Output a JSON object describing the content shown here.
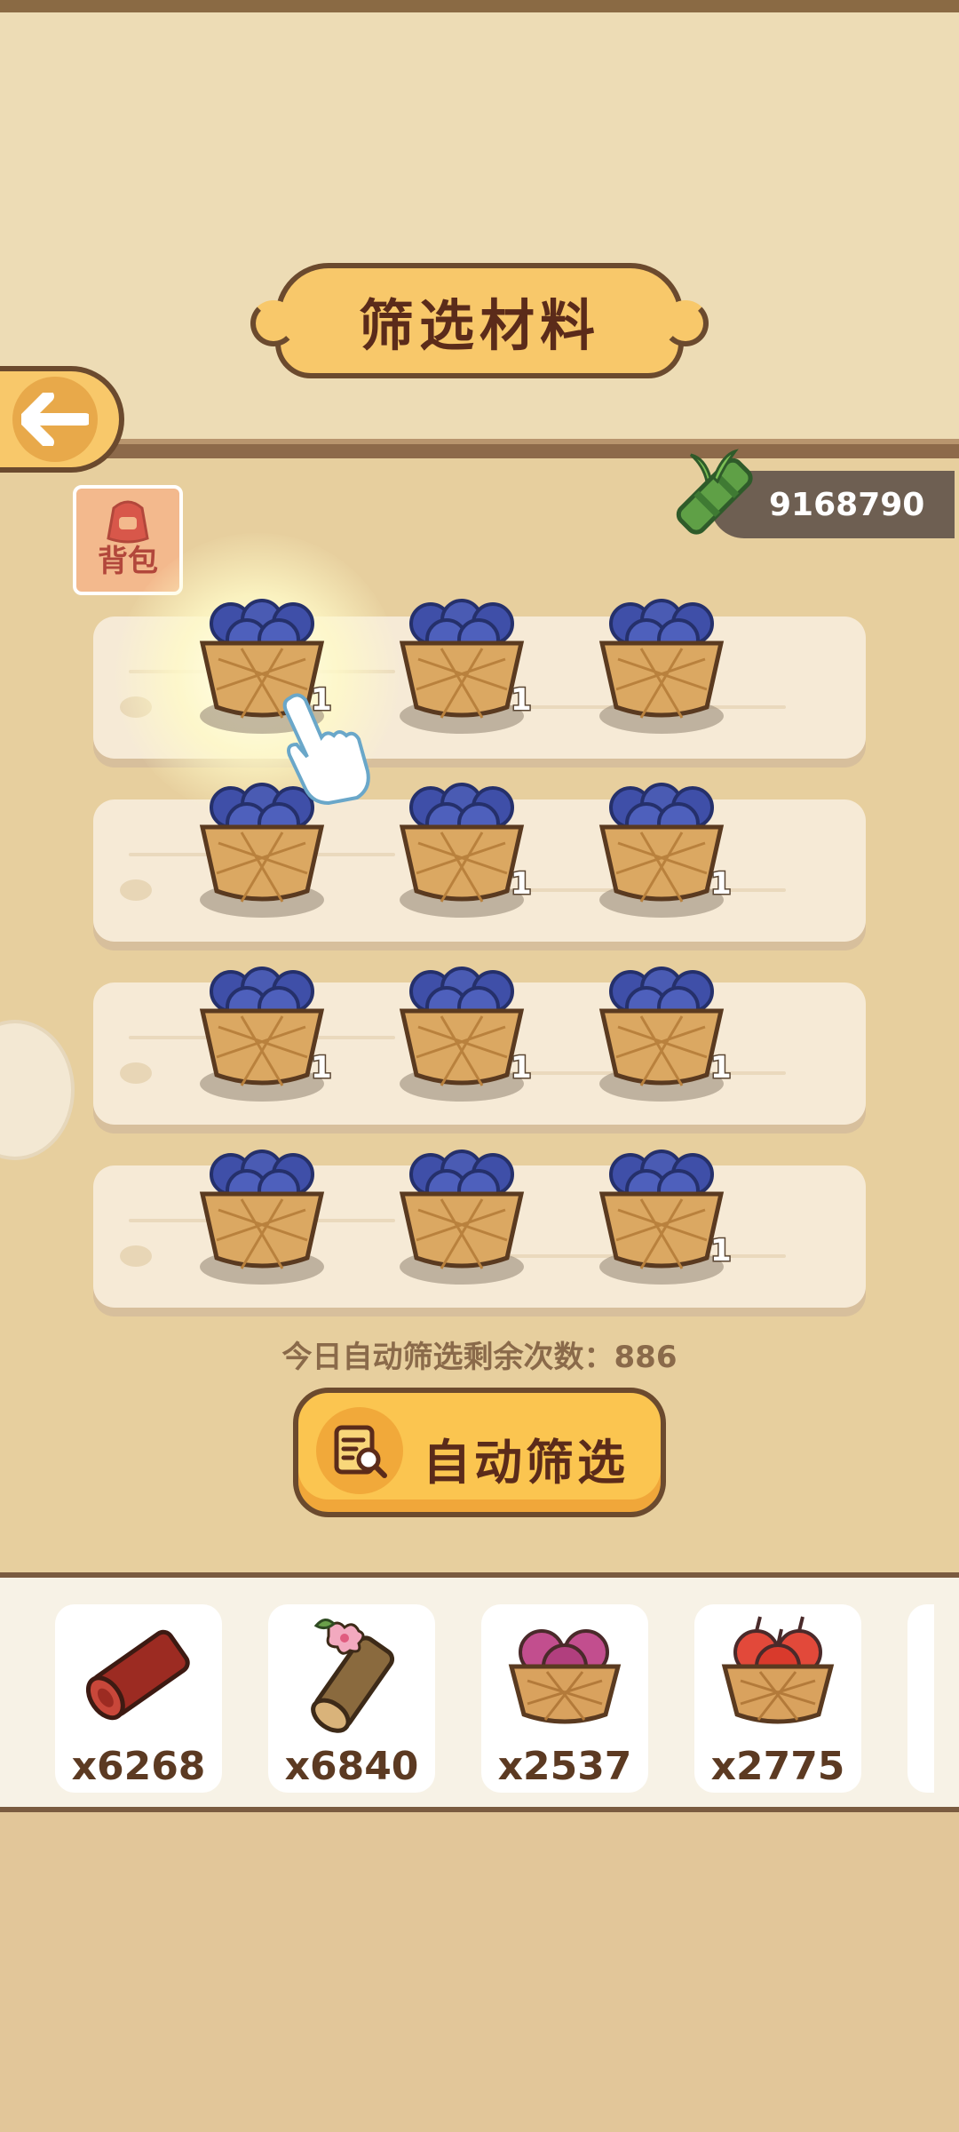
{
  "title": "筛选材料",
  "back_icon": "arrow-left-icon",
  "backpack": {
    "label": "背包",
    "icon": "backpack-icon"
  },
  "currency": {
    "icon": "bamboo-icon",
    "amount": "9168790"
  },
  "grid": {
    "rows": [
      [
        {
          "item": "blueberry-basket",
          "qty": "1"
        },
        {
          "item": "blueberry-basket",
          "qty": "1"
        },
        {
          "item": "blueberry-basket",
          "qty": ""
        }
      ],
      [
        {
          "item": "blueberry-basket",
          "qty": ""
        },
        {
          "item": "blueberry-basket",
          "qty": "1"
        },
        {
          "item": "blueberry-basket",
          "qty": "1"
        }
      ],
      [
        {
          "item": "blueberry-basket",
          "qty": "1"
        },
        {
          "item": "blueberry-basket",
          "qty": "1"
        },
        {
          "item": "blueberry-basket",
          "qty": "1"
        }
      ],
      [
        {
          "item": "blueberry-basket",
          "qty": ""
        },
        {
          "item": "blueberry-basket",
          "qty": ""
        },
        {
          "item": "blueberry-basket",
          "qty": "1"
        }
      ]
    ]
  },
  "remaining_text": "今日自动筛选剩余次数：886",
  "auto_button": {
    "label": "自动筛选",
    "icon": "search-list-icon"
  },
  "inventory": [
    {
      "icon": "red-wood-log-icon",
      "count": "x6268"
    },
    {
      "icon": "blossom-log-icon",
      "count": "x6840"
    },
    {
      "icon": "rose-basket-icon",
      "count": "x2537"
    },
    {
      "icon": "apple-basket-icon",
      "count": "x2775"
    }
  ],
  "colors": {
    "accent": "#fbc550",
    "outline": "#6b4a2e",
    "title_text": "#5b2b1a",
    "berry": "#4a5bb3"
  }
}
